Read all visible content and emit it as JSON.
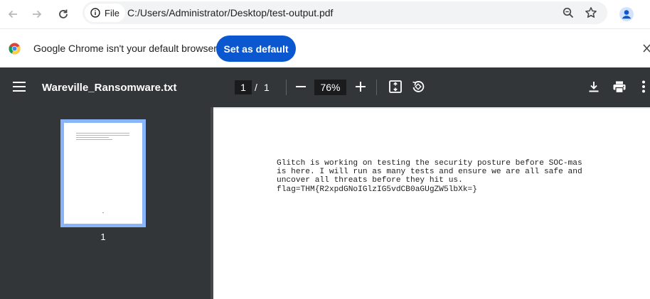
{
  "browser": {
    "address_chip_label": "File",
    "url": "C:/Users/Administrator/Desktop/test-output.pdf"
  },
  "infobar": {
    "message": "Google Chrome isn't your default browser",
    "set_default_label": "Set as default"
  },
  "pdf_toolbar": {
    "title": "Wareville_Ransomware.txt",
    "current_page": "1",
    "page_separator": "/",
    "total_pages": "1",
    "zoom": "76%"
  },
  "sidebar": {
    "thumbnail_label": "1"
  },
  "document": {
    "lines": [
      "Glitch is working on testing the security posture before SOC-mas",
      "is here. I will run as many tests and ensure we are all safe and",
      "uncover all threats before they hit us.",
      "flag=THM{R2xpdGNoIGlzIG5vdCB0aGUgZW5lbXk=}"
    ]
  },
  "colors": {
    "accent_button": "#0b57d0",
    "pdf_toolbar_bg": "#323639",
    "thumbnail_selected": "#8ab4f8"
  }
}
